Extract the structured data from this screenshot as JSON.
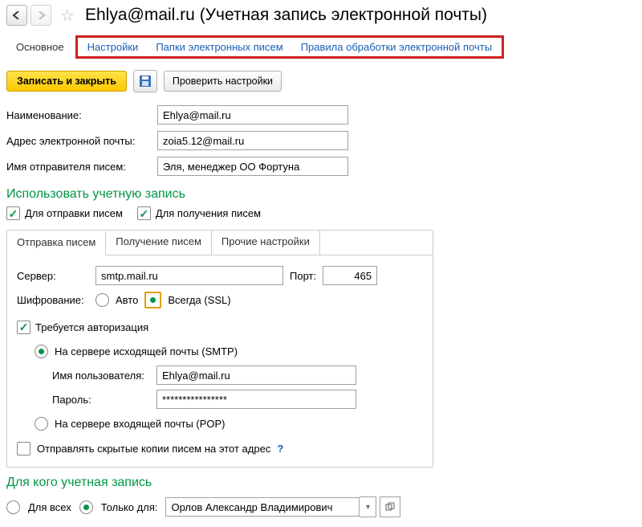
{
  "title": "Ehlya@mail.ru (Учетная запись электронной почты)",
  "mainTab": "Основное",
  "links": {
    "settings": "Настройки",
    "folders": "Папки электронных писем",
    "rules": "Правила обработки электронной почты"
  },
  "toolbar": {
    "save": "Записать и закрыть",
    "check": "Проверить настройки"
  },
  "fields": {
    "nameLabel": "Наименование:",
    "name": "Ehlya@mail.ru",
    "emailLabel": "Адрес электронной почты:",
    "email": "zoia5.12@mail.ru",
    "senderLabel": "Имя отправителя писем:",
    "sender": "Эля, менеджер ОО Фортуна"
  },
  "use": {
    "header": "Использовать учетную запись",
    "send": "Для отправки писем",
    "recv": "Для получения писем"
  },
  "tabs": {
    "send": "Отправка писем",
    "recv": "Получение писем",
    "other": "Прочие настройки"
  },
  "smtp": {
    "serverLabel": "Сервер:",
    "server": "smtp.mail.ru",
    "portLabel": "Порт:",
    "port": "465",
    "encLabel": "Шифрование:",
    "auto": "Авто",
    "ssl": "Всегда (SSL)",
    "authReq": "Требуется авторизация",
    "onSmtp": "На сервере исходящей почты (SMTP)",
    "userLabel": "Имя пользователя:",
    "user": "Ehlya@mail.ru",
    "passLabel": "Пароль:",
    "pass": "****************",
    "onPop": "На сервере входящей почты (POP)",
    "hidden": "Отправлять скрытые копии писем на этот адрес",
    "q": "?"
  },
  "whom": {
    "header": "Для кого учетная запись",
    "all": "Для всех",
    "only": "Только для:",
    "user": "Орлов Александр Владимирович"
  }
}
